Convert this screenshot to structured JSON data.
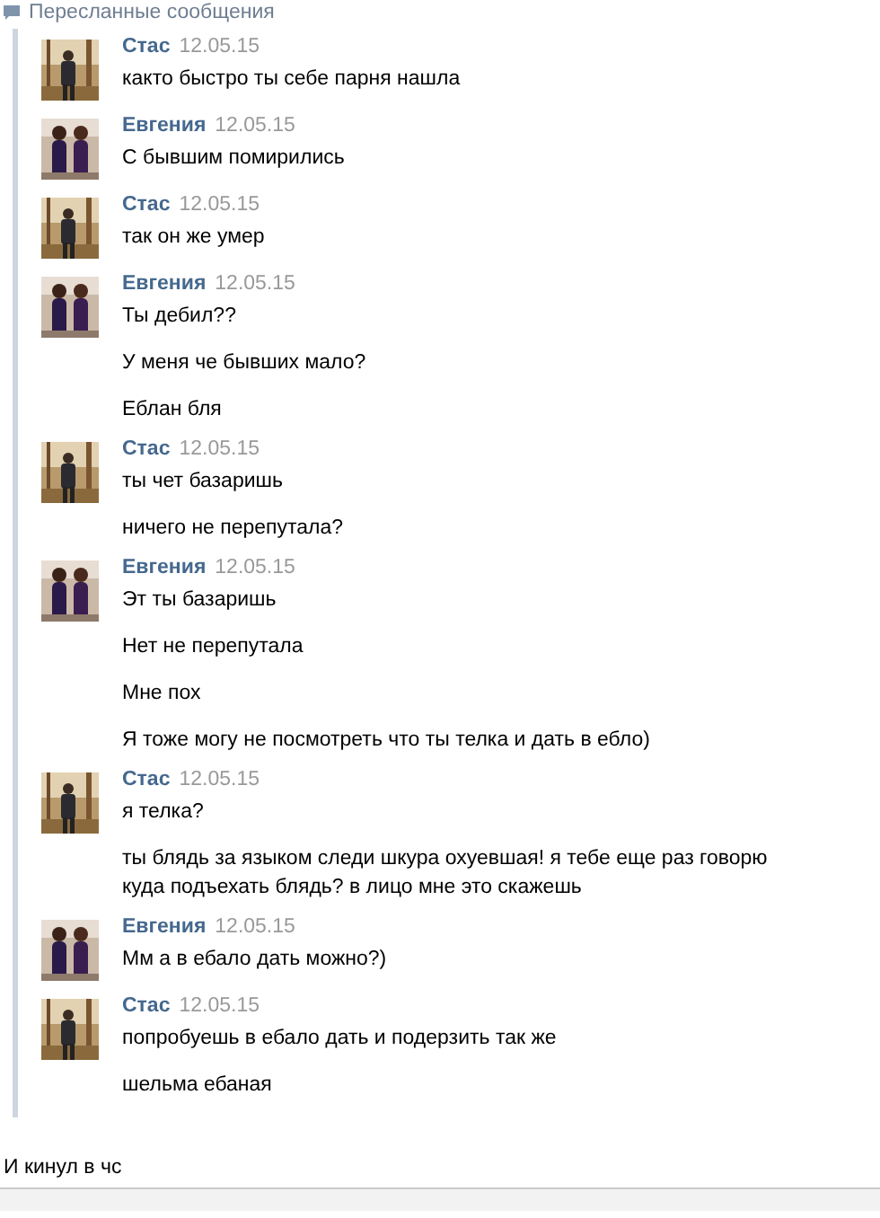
{
  "forwarded_header": "Пересланные сообщения",
  "messages": [
    {
      "author": "Стас",
      "date": "12.05.15",
      "paragraphs": [
        "както быстро ты себе парня нашла"
      ]
    },
    {
      "author": "Евгения",
      "date": "12.05.15",
      "paragraphs": [
        "С бывшим помирились"
      ]
    },
    {
      "author": "Стас",
      "date": "12.05.15",
      "paragraphs": [
        "так он же умер"
      ]
    },
    {
      "author": "Евгения",
      "date": "12.05.15",
      "paragraphs": [
        "Ты дебил??",
        "У меня че бывших мало?",
        "Еблан бля"
      ]
    },
    {
      "author": "Стас",
      "date": "12.05.15",
      "paragraphs": [
        "ты чет базаришь",
        "ничего не перепутала?"
      ]
    },
    {
      "author": "Евгения",
      "date": "12.05.15",
      "paragraphs": [
        "Эт ты базаришь",
        "Нет не перепутала",
        "Мне пох",
        "Я тоже могу не посмотреть что ты телка и дать в ебло)"
      ]
    },
    {
      "author": "Стас",
      "date": "12.05.15",
      "paragraphs": [
        "я телка?",
        "ты блядь за языком следи шкура охуевшая! я тебе еще раз говорю куда подъехать блядь? в лицо мне это скажешь"
      ]
    },
    {
      "author": "Евгения",
      "date": "12.05.15",
      "paragraphs": [
        "Мм а в ебало дать можно?)"
      ]
    },
    {
      "author": "Стас",
      "date": "12.05.15",
      "paragraphs": [
        "попробуешь в ебало дать и подерзить так же",
        "шельма ебаная"
      ]
    }
  ],
  "caption": "И кинул в чс"
}
